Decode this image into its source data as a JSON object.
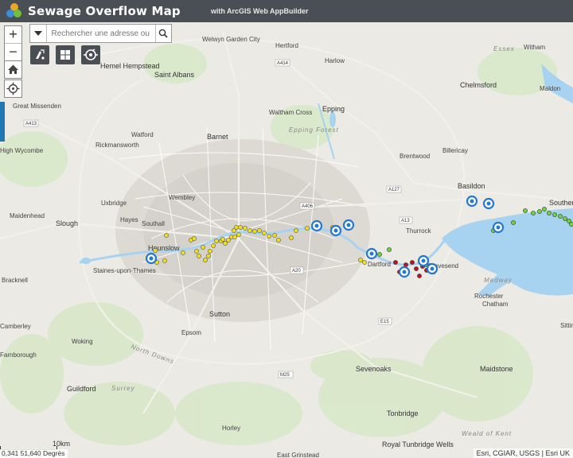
{
  "app": {
    "title": "Sewage Overflow Map",
    "subtitle": "with ArcGIS Web AppBuilder"
  },
  "search": {
    "placeholder": "Rechercher une adresse ou"
  },
  "zoom": {
    "in": "+",
    "out": "−"
  },
  "tools": [
    "layers-tool",
    "basemap-gallery-tool",
    "legend-tool"
  ],
  "status": {
    "coordinates": "0,341 51,640 Degrés",
    "scale_label": "10km",
    "attribution": "Esri, CGIAR, USGS | Esri UK"
  },
  "colors": {
    "header": "#4a4f55",
    "water": "#a8d3f0",
    "yellow_points": "#f0e01a",
    "green_points": "#6dd63a",
    "red_points": "#c0121a",
    "blue_circles": "#2478d4",
    "accent_tab": "#1f77b4"
  },
  "place_labels": [
    "Welwyn Garden City",
    "Hertford",
    "Harlow",
    "Essex",
    "Witham",
    "Hemel Hempstead",
    "Saint Albans",
    "Chelmsford",
    "Maldon",
    "Great Missenden",
    "Waltham Cross",
    "Epping",
    "Epping Forest",
    "Watford",
    "Barnet",
    "Rickmansworth",
    "Brentwood",
    "Billericay",
    "High Wycombe",
    "Uxbridge",
    "Wembley",
    "Basildon",
    "Maidenhead",
    "Hayes",
    "Southall",
    "Slough",
    "Hounslow",
    "Thurrock",
    "Staines-upon-Thames",
    "Dartford",
    "Gravesend",
    "Bracknell",
    "Medway",
    "Rochester",
    "Chatham",
    "Camberley",
    "Epsom",
    "Sutton",
    "Woking",
    "North Downs",
    "Farnborough",
    "Guildford",
    "Surrey",
    "Sevenoaks",
    "Maidstone",
    "Tonbridge",
    "Horley",
    "Royal Tunbridge Wells",
    "East Grinstead",
    "Weald of Kent",
    "Southend",
    "Sittingbourne"
  ],
  "road_labels": [
    "A414",
    "A406",
    "A127",
    "A13",
    "A20",
    "E15",
    "M25",
    "A413"
  ]
}
